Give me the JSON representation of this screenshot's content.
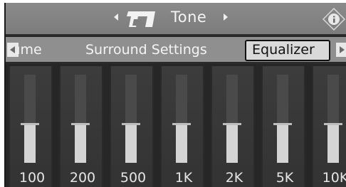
{
  "header": {
    "title": "Tone",
    "logo_text": "T7"
  },
  "tabs": [
    {
      "label": "Volume",
      "selected": false
    },
    {
      "label": "Surround Settings",
      "selected": false
    },
    {
      "label": "Equalizer",
      "selected": true
    }
  ],
  "equalizer": {
    "bands": [
      {
        "label": "100",
        "level": 0.52
      },
      {
        "label": "200",
        "level": 0.52
      },
      {
        "label": "500",
        "level": 0.52
      },
      {
        "label": "1K",
        "level": 0.52
      },
      {
        "label": "2K",
        "level": 0.52
      },
      {
        "label": "5K",
        "level": 0.52
      },
      {
        "label": "10K",
        "level": 0.52
      }
    ]
  },
  "colors": {
    "title_bar": "#8a8a8a",
    "tab_bar": "#8f8f8f",
    "selected_tab": "#d9d9d9",
    "background": "#262626",
    "slider_fill": "#d4d4d4"
  }
}
